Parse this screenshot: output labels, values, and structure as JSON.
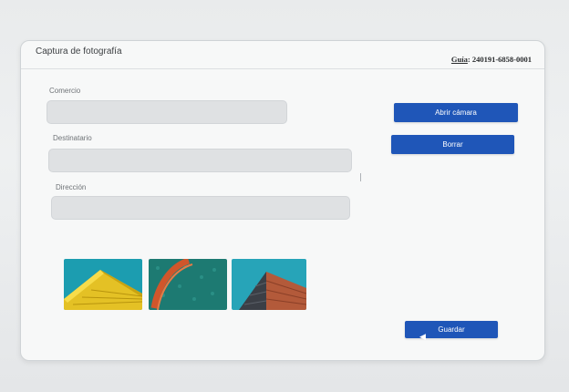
{
  "panel": {
    "title": "Captura de fotografía",
    "guide_label": "Guía",
    "guide_value": ": 240191-6858-0001"
  },
  "fields": {
    "comercio": {
      "label": "Comercio",
      "value": ""
    },
    "destinatario": {
      "label": "Destinatario",
      "value": ""
    },
    "direccion": {
      "label": "Dirección",
      "value": ""
    }
  },
  "buttons": {
    "open_camera": "Abrir cámara",
    "clear": "Borrar",
    "save": "Guardar"
  },
  "thumbnails": [
    {
      "icon": "yellow-building-photo"
    },
    {
      "icon": "teal-curve-photo"
    },
    {
      "icon": "brick-building-photo"
    }
  ],
  "colors": {
    "button": "#1f56b8",
    "field": "#dfe1e3"
  }
}
